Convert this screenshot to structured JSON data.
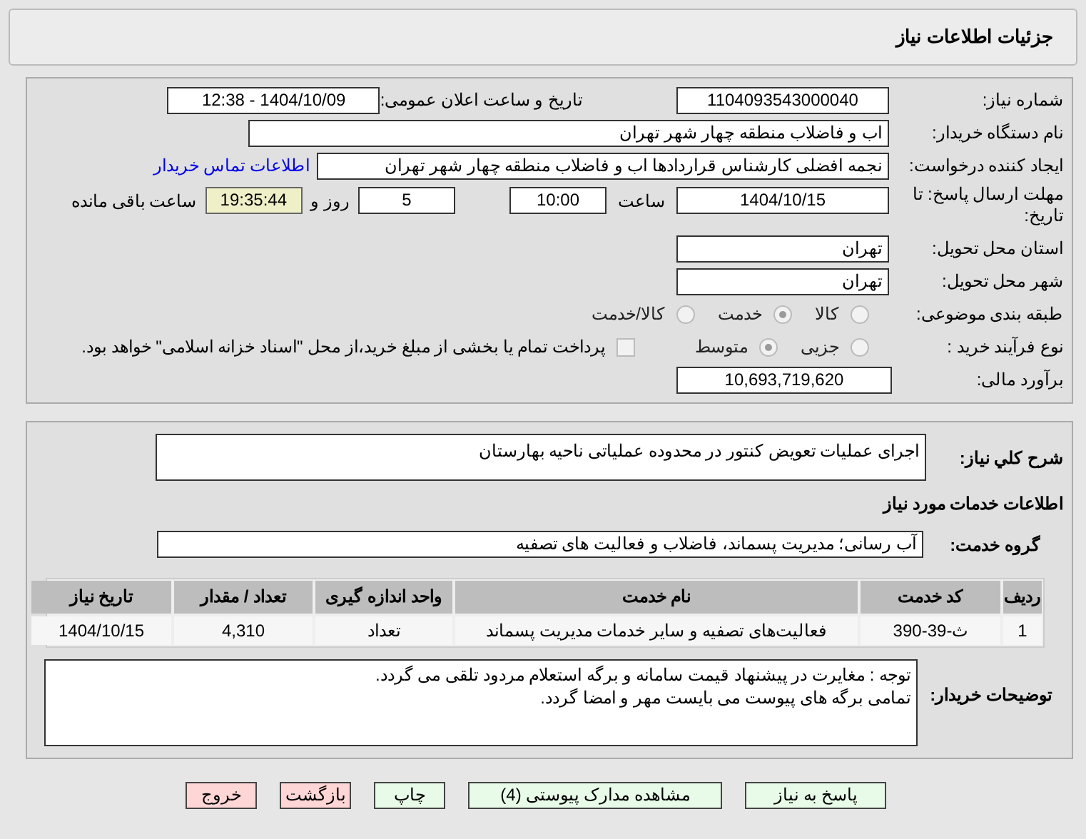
{
  "page_title": "جزئیات اطلاعات نیاز",
  "need_number": {
    "label": "شماره نیاز:",
    "value": "1104093543000040"
  },
  "announce": {
    "label": "تاریخ و ساعت اعلان عمومی:",
    "value": "1404/10/09 - 12:38"
  },
  "buyer_org": {
    "label": "نام دستگاه خریدار:",
    "value": "اب و فاضلاب منطقه چهار شهر تهران"
  },
  "requester": {
    "label": "ایجاد کننده درخواست:",
    "value": "نجمه افضلی کارشناس قراردادها اب و فاضلاب منطقه چهار شهر تهران",
    "link": "اطلاعات تماس خریدار"
  },
  "deadline": {
    "label": "مهلت ارسال پاسخ: تا تاریخ:",
    "date": "1404/10/15",
    "time_label": "ساعت",
    "time": "10:00",
    "days": "5",
    "days_label": "روز و",
    "remaining": "19:35:44",
    "remaining_label": "ساعت باقی مانده"
  },
  "province": {
    "label": "استان محل تحویل:",
    "value": "تهران"
  },
  "city": {
    "label": "شهر محل تحویل:",
    "value": "تهران"
  },
  "category": {
    "label": "طبقه بندی موضوعی:",
    "options": [
      {
        "label": "کالا",
        "selected": false
      },
      {
        "label": "خدمت",
        "selected": true
      },
      {
        "label": "کالا/خدمت",
        "selected": false
      }
    ]
  },
  "process": {
    "label": "نوع فرآیند خرید :",
    "options": [
      {
        "label": "جزیی",
        "selected": false
      },
      {
        "label": "متوسط",
        "selected": true
      }
    ],
    "payment": {
      "label": "پرداخت تمام یا بخشی از مبلغ خرید،از محل \"اسناد خزانه اسلامی\" خواهد بود.",
      "checked": false
    }
  },
  "budget": {
    "label": "برآورد مالی:",
    "value": "10,693,719,620"
  },
  "description": {
    "label": "شرح کلي نياز:",
    "value": "اجرای عملیات تعویض کنتور در محدوده عملیاتی ناحیه بهارستان"
  },
  "services_heading": "اطلاعات خدمات مورد نیاز",
  "service_group": {
    "label": "گروه خدمت:",
    "value": "آب رسانی؛ مدیریت پسماند، فاضلاب و فعالیت های تصفیه"
  },
  "table": {
    "columns": [
      "ردیف",
      "کد خدمت",
      "نام خدمت",
      "واحد اندازه گیری",
      "تعداد / مقدار",
      "تاریخ نیاز"
    ],
    "rows": [
      [
        "1",
        "ث-39-390",
        "فعالیت‌های تصفیه و سایر خدمات مدیریت پسماند",
        "تعداد",
        "4,310",
        "1404/10/15"
      ]
    ]
  },
  "buyer_notes": {
    "label": "توضیحات خریدار:",
    "lines": [
      "توجه : مغایرت در پیشنهاد قیمت سامانه و برگه استعلام مردود تلقی می گردد.",
      "تمامی برگه های پیوست می بایست مهر و امضا گردد."
    ]
  },
  "buttons": [
    {
      "label": "پاسخ به نیاز",
      "kind": "green"
    },
    {
      "label": "مشاهده مدارک پیوستی (4)",
      "kind": "green"
    },
    {
      "label": "چاپ",
      "kind": "green"
    },
    {
      "label": "بازگشت",
      "kind": "red"
    },
    {
      "label": "خروج",
      "kind": "red"
    }
  ]
}
